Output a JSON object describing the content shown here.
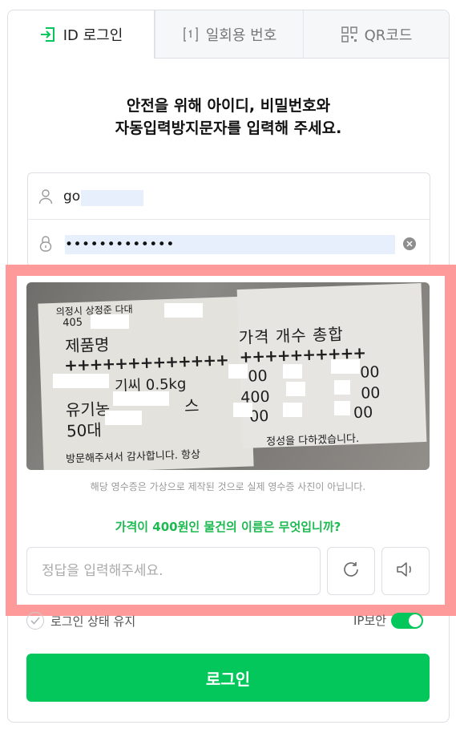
{
  "tabs": [
    {
      "label": "ID 로그인",
      "icon": "id-login-icon",
      "active": true
    },
    {
      "label": "일회용 번호",
      "icon": "one-time-number-icon",
      "active": false
    },
    {
      "label": "QR코드",
      "icon": "qr-code-icon",
      "active": false
    }
  ],
  "headline": [
    "안전을 위해 아이디, 비밀번호와",
    "자동입력방지문자를 입력해 주세요."
  ],
  "id_field": {
    "value": "go",
    "icon": "user-icon"
  },
  "password_field": {
    "value": "•••••••••••••",
    "icon": "lock-icon",
    "clear_icon": "clear-icon"
  },
  "captcha": {
    "left_receipt": [
      "의정시 상정준 다대",
      "405",
      "제품명",
      "+++++++++++++",
      "기씨 0.5kg",
      "유기농",
      "스",
      "50대",
      "방문해주셔서 감사합니다. 항상"
    ],
    "right_receipt": [
      "가격 개수 총합",
      "++++++++++",
      "00",
      "400",
      "00",
      "00",
      "00",
      "00",
      "정성을 다하겠습니다."
    ]
  },
  "captcha_note": "해당 영수증은 가상으로 제작된 것으로 실제 영수증 사진이 아닙니다.",
  "captcha_question": "가격이 400원인 물건의 이름은 무엇입니까?",
  "answer_input": {
    "placeholder": "정답을 입력해주세요."
  },
  "refresh_icon": "refresh-icon",
  "audio_icon": "speaker-icon",
  "keep_login_label": "로그인 상태 유지",
  "ip_security_label": "IP보안",
  "ip_security_on": true,
  "login_button": "로그인",
  "colors": {
    "brand": "#03c75a",
    "question": "#1db951",
    "highlight": "#ff9a9a"
  }
}
